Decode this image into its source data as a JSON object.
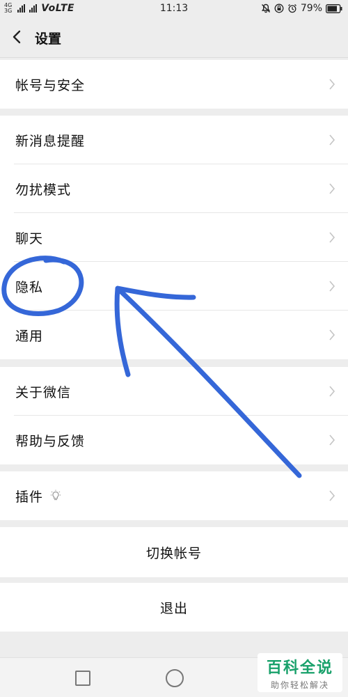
{
  "status": {
    "network_small": [
      "4G",
      "3G"
    ],
    "volte": "VoLTE",
    "time": "11:13",
    "battery": "79%"
  },
  "header": {
    "back_icon": "chevron-left-icon",
    "title": "设置"
  },
  "groups": [
    {
      "items": [
        {
          "label": "帐号与安全"
        }
      ]
    },
    {
      "items": [
        {
          "label": "新消息提醒"
        },
        {
          "label": "勿扰模式"
        },
        {
          "label": "聊天"
        },
        {
          "label": "隐私"
        },
        {
          "label": "通用"
        }
      ]
    },
    {
      "items": [
        {
          "label": "关于微信"
        },
        {
          "label": "帮助与反馈"
        }
      ]
    },
    {
      "items": [
        {
          "label": "插件",
          "badge_icon": "plugin-bulb-icon"
        }
      ]
    }
  ],
  "actions": {
    "switch_account": "切换帐号",
    "logout": "退出"
  },
  "watermark": {
    "title": "百科全说",
    "subtitle": "助你轻松解决"
  },
  "annotation_color": "#3567d8"
}
